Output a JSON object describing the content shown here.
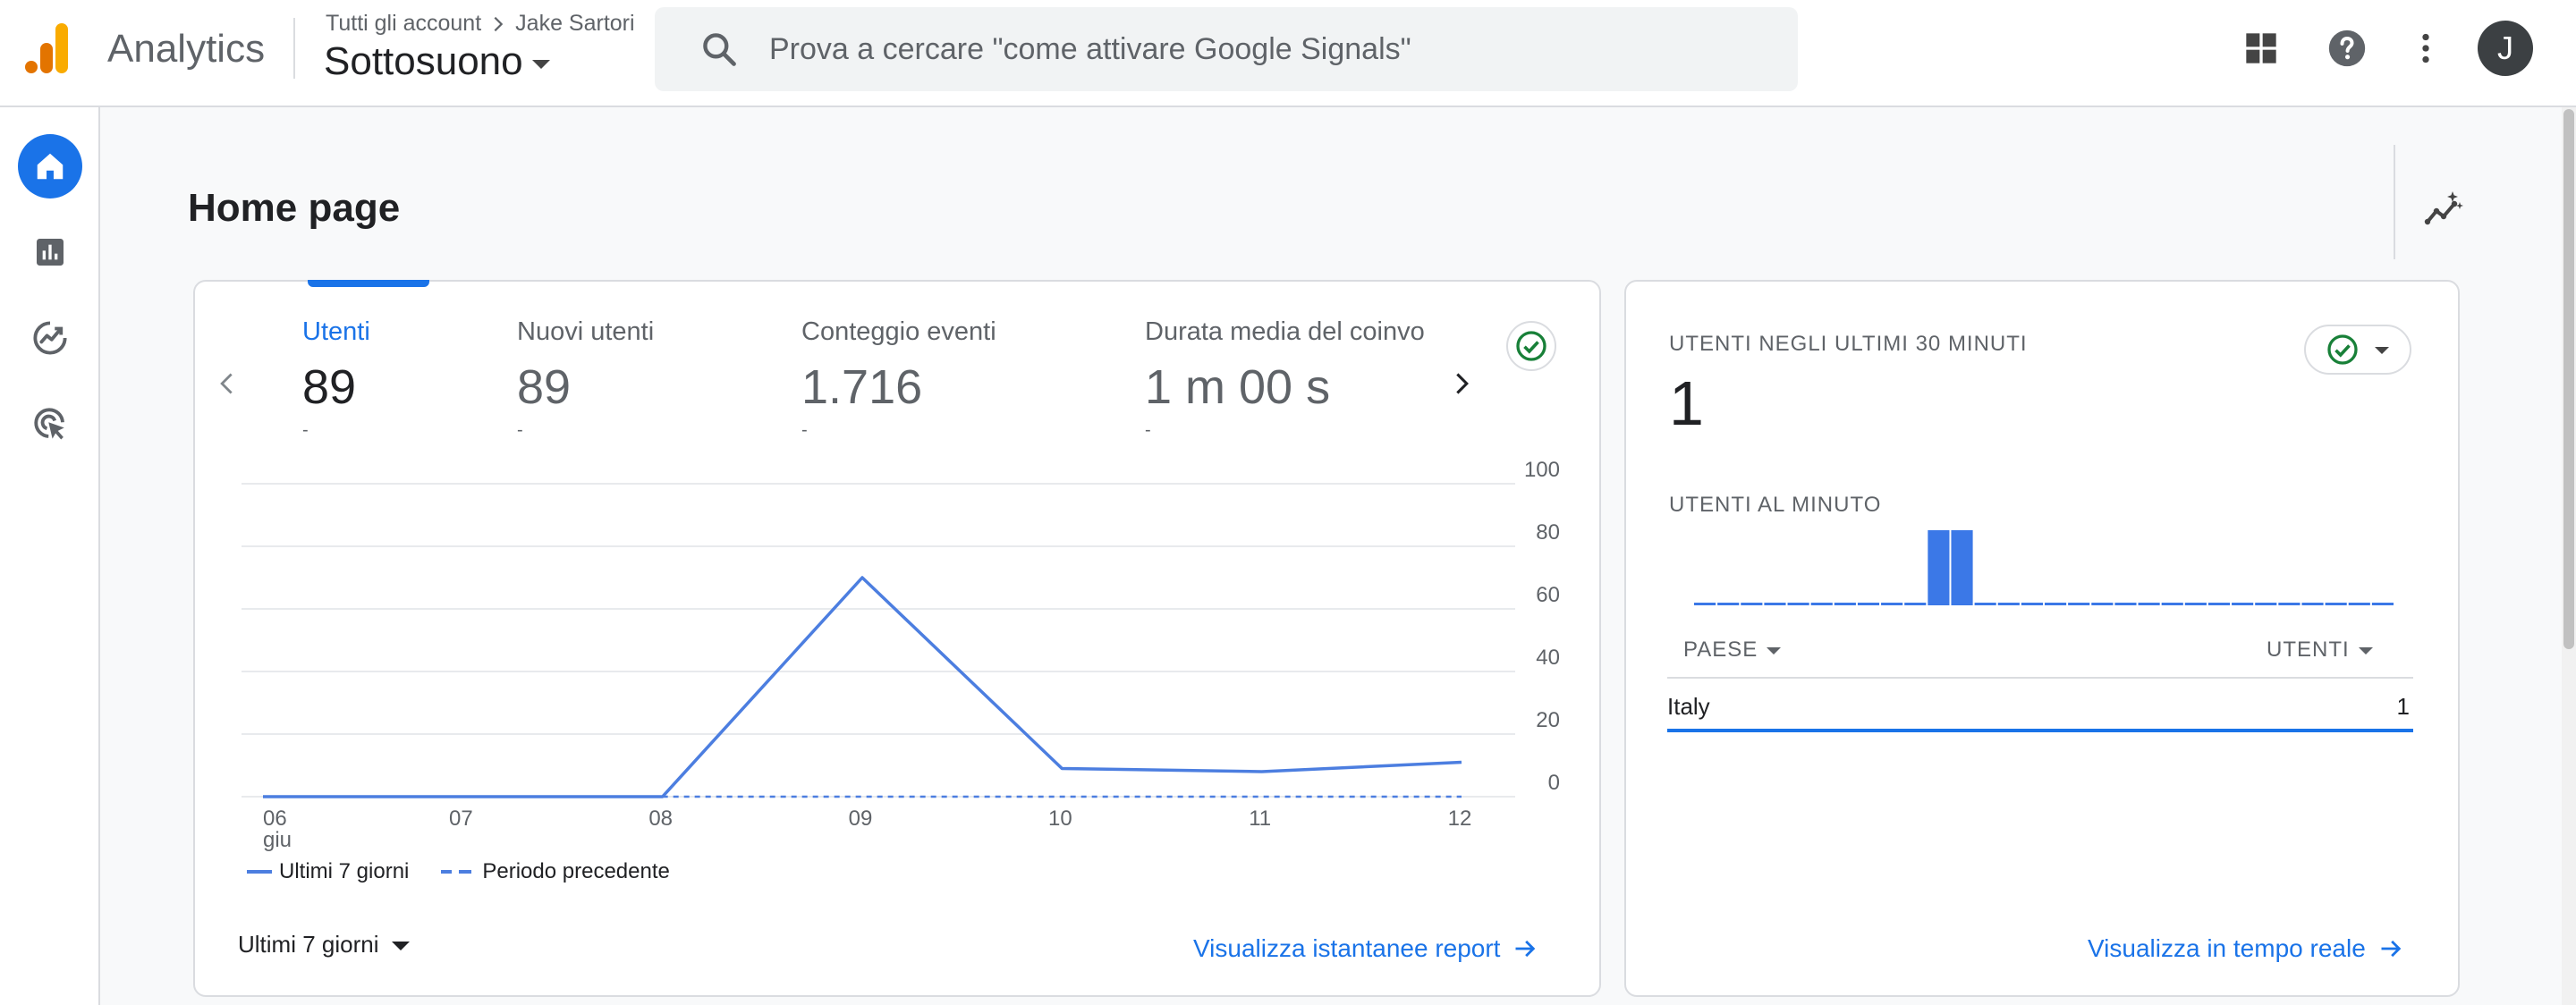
{
  "header": {
    "app_name": "Analytics",
    "breadcrumb": {
      "account": "Tutti gli account",
      "name": "Jake Sartori"
    },
    "property": "Sottosuono",
    "search_placeholder": "Prova a cercare \"come attivare Google Signals\"",
    "user_initial": "J",
    "icons": [
      "analytics-logo",
      "search-icon",
      "apps-icon",
      "help-icon",
      "more-vert-icon"
    ]
  },
  "nav": {
    "items": [
      {
        "name": "home",
        "icon": "home-icon",
        "active": true
      },
      {
        "name": "reports",
        "icon": "bar-chart-icon",
        "active": false
      },
      {
        "name": "explore",
        "icon": "explore-icon",
        "active": false
      },
      {
        "name": "advertising",
        "icon": "ads-click-icon",
        "active": false
      }
    ]
  },
  "page": {
    "title": "Home page",
    "insights_icon": "insights-icon"
  },
  "overview": {
    "metrics": [
      {
        "label": "Utenti",
        "value": "89",
        "change": "-",
        "selected": true
      },
      {
        "label": "Nuovi utenti",
        "value": "89",
        "change": "-",
        "selected": false
      },
      {
        "label": "Conteggio eventi",
        "value": "1.716",
        "change": "-",
        "selected": false
      },
      {
        "label": "Durata media del coinvo",
        "value": "1 m 00 s",
        "change": "-",
        "selected": false
      }
    ],
    "legend": {
      "current": "Ultimi 7 giorni",
      "previous": "Periodo precedente"
    },
    "date_range": "Ultimi 7 giorni",
    "link": "Visualizza istantanee report"
  },
  "chart_data": {
    "type": "line",
    "x": [
      "06",
      "07",
      "08",
      "09",
      "10",
      "11",
      "12"
    ],
    "x_sublabel": "giu",
    "series": [
      {
        "name": "Ultimi 7 giorni",
        "values": [
          0,
          0,
          0,
          70,
          9,
          8,
          11
        ],
        "style": "solid"
      },
      {
        "name": "Periodo precedente",
        "values": [
          null,
          null,
          0,
          0,
          0,
          0,
          0
        ],
        "style": "dashed"
      }
    ],
    "yticks": [
      0,
      20,
      40,
      60,
      80,
      100
    ],
    "ylim": [
      0,
      100
    ],
    "grid": true,
    "color": "#4c7ee0"
  },
  "realtime": {
    "title": "UTENTI NEGLI ULTIMI 30 MINUTI",
    "value": "1",
    "subtitle": "UTENTI AL MINUTO",
    "per_minute": [
      0,
      0,
      0,
      0,
      0,
      0,
      0,
      0,
      0,
      0,
      1,
      1,
      0,
      0,
      0,
      0,
      0,
      0,
      0,
      0,
      0,
      0,
      0,
      0,
      0,
      0,
      0,
      0,
      0,
      0
    ],
    "table_headers": {
      "country": "PAESE",
      "users": "UTENTI"
    },
    "rows": [
      {
        "country": "Italy",
        "users": "1"
      }
    ],
    "link": "Visualizza in tempo reale"
  },
  "colors": {
    "accent": "#1a73e8",
    "chart_line": "#4c7ee0",
    "success": "#188038"
  }
}
